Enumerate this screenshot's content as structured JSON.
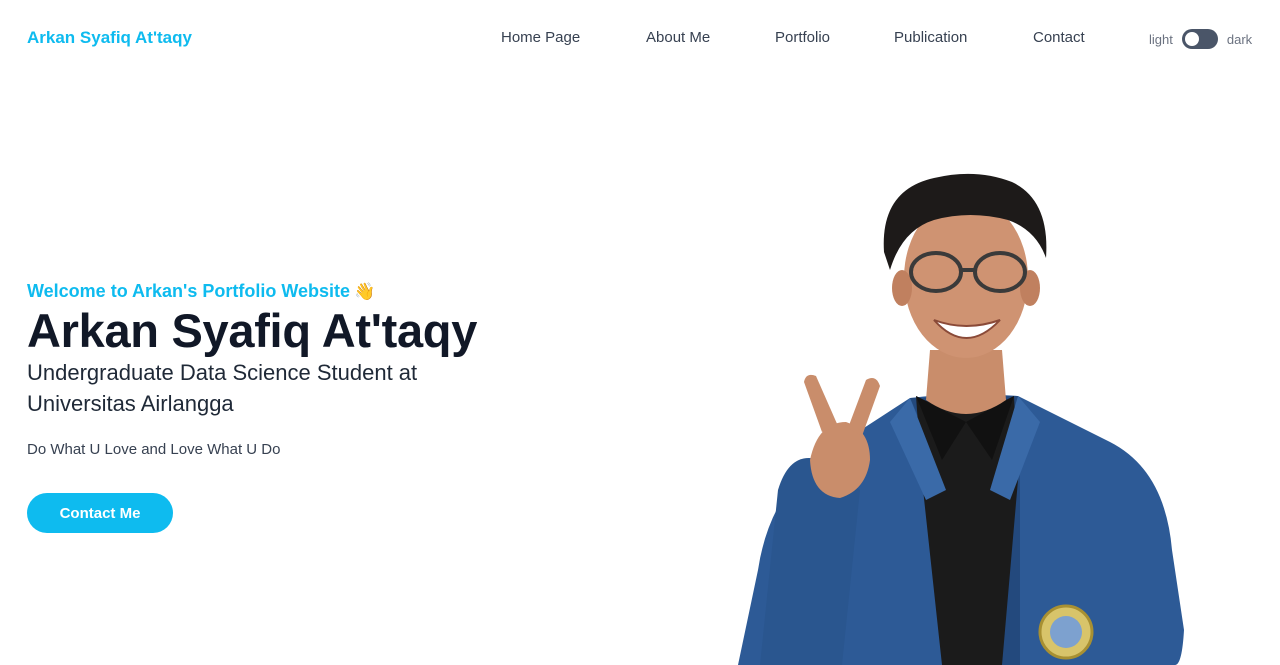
{
  "header": {
    "brand": "Arkan Syafiq At'taqy",
    "nav": [
      {
        "label": "Home Page"
      },
      {
        "label": "About Me"
      },
      {
        "label": "Portfolio"
      },
      {
        "label": "Publication"
      },
      {
        "label": "Contact"
      }
    ],
    "theme_toggle": {
      "left_label": "light",
      "right_label": "dark",
      "state": "light"
    }
  },
  "hero": {
    "welcome": "Welcome to Arkan's Portfolio Website",
    "welcome_emoji": "👋",
    "name": "Arkan Syafiq At'taqy",
    "role": "Undergraduate Data Science Student at Universitas Airlangga",
    "tagline": "Do What U Love and Love What U Do",
    "cta_label": "Contact Me"
  },
  "colors": {
    "accent": "#0ebbef",
    "heading": "#111827",
    "toggle_track": "#4a5568",
    "jacket": "#2d5a96"
  },
  "icons": {
    "wave": "waving-hand-icon",
    "toggle": "theme-toggle-icon"
  }
}
